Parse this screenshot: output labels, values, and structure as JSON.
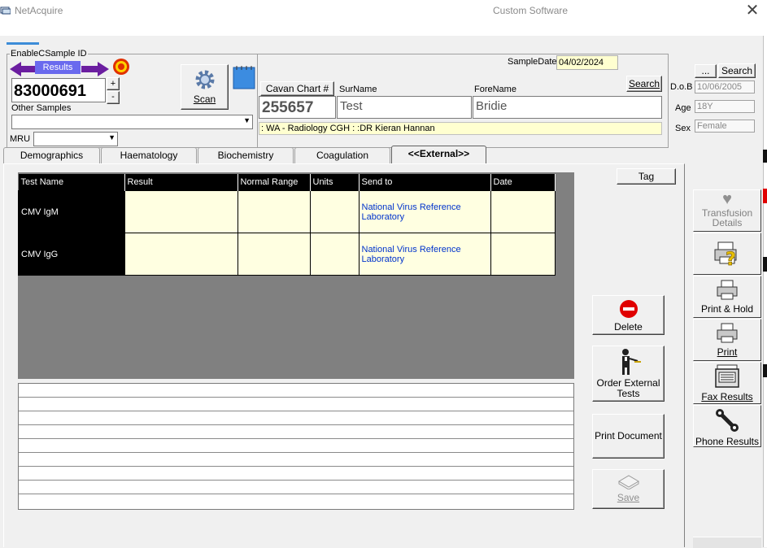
{
  "window": {
    "app_title": "NetAcquire",
    "center_title": "Custom Software",
    "close_glyph": "✕"
  },
  "sample": {
    "group_label": "EnableCSample ID",
    "results_label": "Results",
    "sample_id": "83000691",
    "other_samples_label": "Other Samples",
    "mru_label": "MRU",
    "plus": "+",
    "minus": "-",
    "scan_label": "Scan"
  },
  "patient": {
    "sample_date_label": "SampleDate",
    "sample_date": "04/02/2024",
    "search_label": "Search",
    "search_top_label": "Search",
    "ellipsis_label": "...",
    "chart_label": "Cavan Chart #",
    "chart_value": "255657",
    "surname_label": "SurName",
    "surname_value": "Test",
    "forename_label": "ForeName",
    "forename_value": "Bridie",
    "location": ": WA - Radiology CGH : :DR Kieran Hannan",
    "dob_label": "D.o.B",
    "dob_value": "10/06/2005",
    "age_label": "Age",
    "age_value": "18Y",
    "sex_label": "Sex",
    "sex_value": "Female"
  },
  "tabs": [
    "Demographics",
    "Haematology",
    "Biochemistry",
    "Coagulation",
    "<<External>>"
  ],
  "tag_label": "Tag",
  "grid": {
    "headers": [
      "Test Name",
      "Result",
      "Normal Range",
      "Units",
      "Send to",
      "Date"
    ],
    "rows": [
      {
        "test": "CMV IgM",
        "result": "",
        "range": "",
        "units": "",
        "send_to": "National Virus Reference Laboratory",
        "date": ""
      },
      {
        "test": "CMV IgG",
        "result": "",
        "range": "",
        "units": "",
        "send_to": "National Virus Reference Laboratory",
        "date": ""
      }
    ]
  },
  "actions": {
    "delete": "Delete",
    "order_external": "Order External Tests",
    "print_document": "Print Document",
    "save": "Save"
  },
  "side": {
    "transfusion": "Transfusion Details",
    "print_hold": "Print & Hold",
    "print": "Print",
    "fax": "Fax Results",
    "phone": "Phone Results"
  },
  "colors": {
    "results_bg": "#6a6aee",
    "arrow": "#6b1ea0",
    "delete_red": "#e00000",
    "send_link": "#0033cc"
  },
  "icons": [
    "app-icon",
    "left-arrow-icon",
    "right-arrow-icon",
    "target-icon",
    "gear-icon",
    "notepad-icon",
    "stop-icon",
    "waiter-icon",
    "save-icon",
    "heart-icon",
    "printer-question-icon",
    "printer-icon",
    "fax-icon",
    "phone-icon"
  ]
}
